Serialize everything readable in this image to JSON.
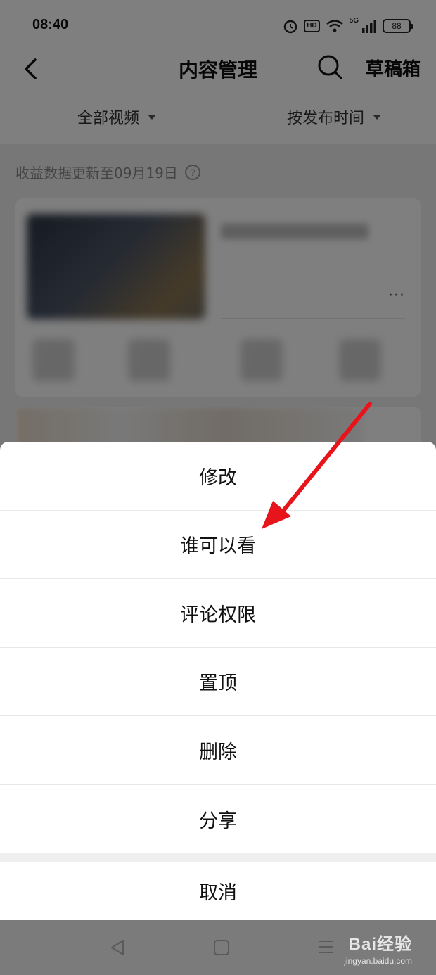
{
  "status_bar": {
    "time": "08:40",
    "hd_label": "HD",
    "network_label": "5G",
    "battery_level": "88"
  },
  "header": {
    "title": "内容管理",
    "drafts_label": "草稿箱"
  },
  "filters": {
    "all_videos": "全部视频",
    "sort_by": "按发布时间"
  },
  "notice": {
    "text": "收益数据更新至09月19日",
    "help_symbol": "?"
  },
  "card": {
    "more_symbol": "···"
  },
  "action_sheet": {
    "items": [
      "修改",
      "谁可以看",
      "评论权限",
      "置顶",
      "删除",
      "分享"
    ],
    "cancel_label": "取消"
  },
  "watermark": {
    "brand": "Bai经验",
    "url": "jingyan.baidu.com"
  },
  "colors": {
    "overlay": "rgba(0,0,0,0.5)",
    "annotation_arrow": "#e8141b",
    "sheet_background": "#ffffff"
  }
}
